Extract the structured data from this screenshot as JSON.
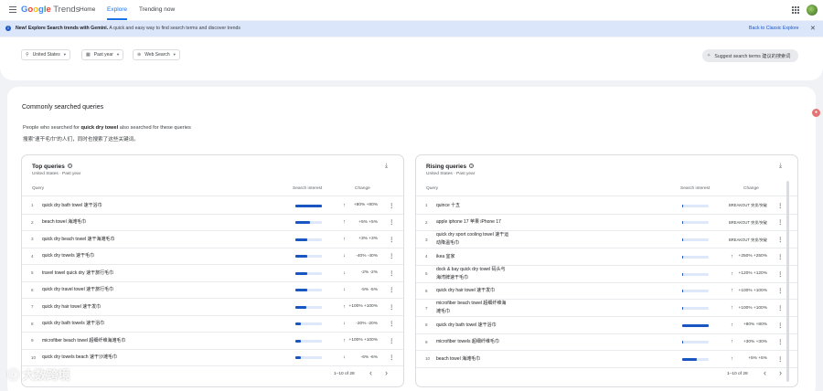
{
  "header": {
    "logo_google": "Google",
    "logo_trends": "Trends",
    "nav": [
      "Home",
      "Explore",
      "Trending now"
    ]
  },
  "banner": {
    "bold": "New! Explore Search trends with Gemini.",
    "text": "A quick and easy way to find search terms and discover trends",
    "back_link": "Back to Classic Explore",
    "close": "✕"
  },
  "filters": {
    "region": "United States",
    "period": "Past year",
    "search_type": "Web Search",
    "suggest": "Suggest search terms 建议的搜索词"
  },
  "section": {
    "title": "Commonly searched queries",
    "line1_prefix": "People who searched for",
    "line1_term": "quick dry towel",
    "line1_suffix": "also searched for these queries",
    "line2": "搜索“速干毛巾”的人们，同时也搜索了这些关键词。"
  },
  "top": {
    "title": "Top queries",
    "meta": "United States · Past year",
    "col_query": "Query",
    "col_interest": "Search interest",
    "col_change": "Change",
    "pagination": "1–10 of 28",
    "rows": [
      {
        "n": "1",
        "q": "quick dry bath towel 速干浴巾",
        "level": 1.0,
        "arrow": "↑",
        "change": "+80% +80%"
      },
      {
        "n": "2",
        "q": "beach towel 海滩毛巾",
        "level": 0.55,
        "arrow": "↑",
        "change": "+5% +5%"
      },
      {
        "n": "3",
        "q": "quick dry beach towel 速干海滩毛巾",
        "level": 0.45,
        "arrow": "↑",
        "change": "+3% +3%"
      },
      {
        "n": "4",
        "q": "quick dry towels 速干毛巾",
        "level": 0.45,
        "arrow": "↓",
        "change": "-40% -40%"
      },
      {
        "n": "5",
        "q": "travel towel quick dry 速干旅行毛巾",
        "level": 0.45,
        "arrow": "↓",
        "change": "-2% -2%"
      },
      {
        "n": "6",
        "q": "quick dry travel towel 速干旅行毛巾",
        "level": 0.45,
        "arrow": "↓",
        "change": "-5% -5%"
      },
      {
        "n": "7",
        "q": "quick dry hair towel 速干发巾",
        "level": 0.42,
        "arrow": "↑",
        "change": "+100% +100%"
      },
      {
        "n": "8",
        "q": "quick dry bath towels 速干浴巾",
        "level": 0.2,
        "arrow": "↓",
        "change": "-20% -20%"
      },
      {
        "n": "9",
        "q": "microfiber beach towel 超细纤维海滩毛巾",
        "level": 0.2,
        "arrow": "↑",
        "change": "+100% +100%"
      },
      {
        "n": "10",
        "q": "quick dry towels beach 速干沙滩毛巾",
        "level": 0.2,
        "arrow": "↓",
        "change": "-6% -6%"
      }
    ]
  },
  "rising": {
    "title": "Rising queries",
    "meta": "United States · Past year",
    "col_query": "Query",
    "col_interest": "Search interest",
    "col_change": "Change",
    "pagination": "1–10 of 28",
    "rows": [
      {
        "n": "1",
        "q": "quince 十五",
        "level": 0.05,
        "arrow": "",
        "change": "BREAKOUT 突发/突破"
      },
      {
        "n": "2",
        "q": "apple iphone 17 苹果 iPhone 17",
        "level": 0.05,
        "arrow": "",
        "change": "BREAKOUT 突发/突破"
      },
      {
        "n": "3",
        "q": "quick dry sport cooling towel 速干运动降温毛巾",
        "level": 0.05,
        "arrow": "",
        "change": "BREAKOUT 突发/突破"
      },
      {
        "n": "4",
        "q": "ikea 宜家",
        "level": 0.05,
        "arrow": "↑",
        "change": "+250% +250%"
      },
      {
        "n": "5",
        "q": "dock & bay quick dry towel 码头与海湾牌速干毛巾",
        "level": 0.05,
        "arrow": "↑",
        "change": "+120% +120%"
      },
      {
        "n": "6",
        "q": "quick dry hair towel 速干发巾",
        "level": 0.05,
        "arrow": "↑",
        "change": "+100% +100%"
      },
      {
        "n": "7",
        "q": "microfiber beach towel 超细纤维海滩毛巾",
        "level": 0.05,
        "arrow": "↑",
        "change": "+100% +100%"
      },
      {
        "n": "8",
        "q": "quick dry bath towel 速干浴巾",
        "level": 1.0,
        "arrow": "↑",
        "change": "+80% +80%"
      },
      {
        "n": "9",
        "q": "microfiber towels 超细纤维毛巾",
        "level": 0.05,
        "arrow": "↑",
        "change": "+30% +30%"
      },
      {
        "n": "10",
        "q": "beach towel 海滩毛巾",
        "level": 0.55,
        "arrow": "↑",
        "change": "+5% +5%"
      }
    ]
  },
  "watermark": "大数跨境"
}
